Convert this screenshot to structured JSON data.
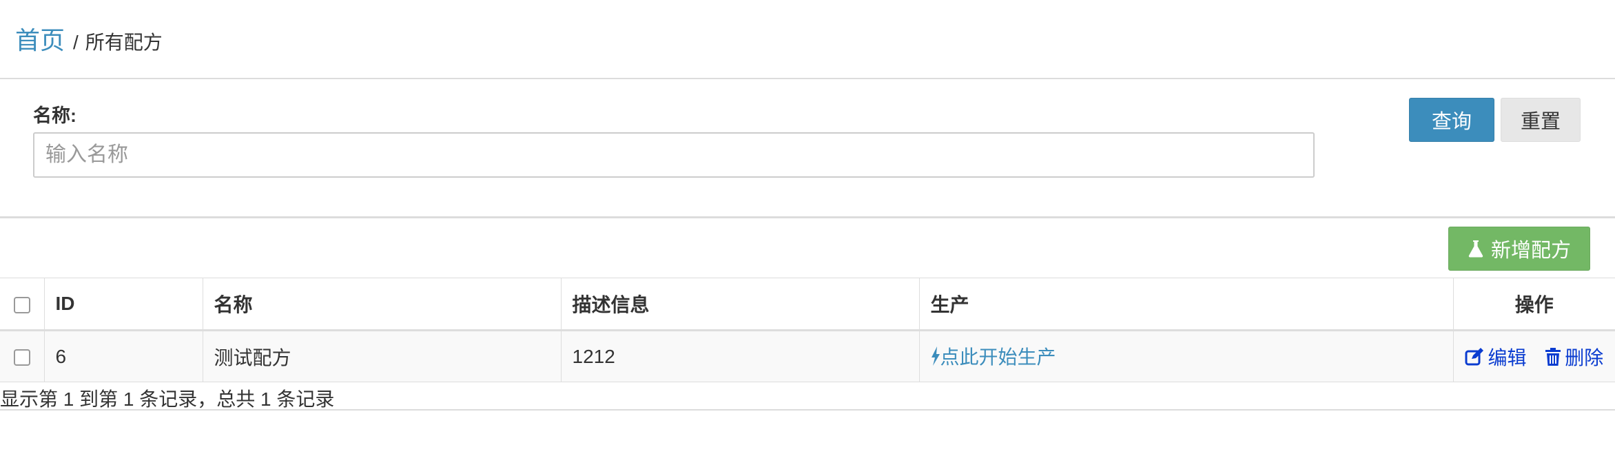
{
  "breadcrumb": {
    "home": "首页",
    "separator": "/",
    "current": "所有配方"
  },
  "filter": {
    "name_label": "名称:",
    "name_placeholder": "输入名称",
    "name_value": ""
  },
  "buttons": {
    "query": "查询",
    "reset": "重置",
    "add": "新增配方"
  },
  "table": {
    "headers": {
      "id": "ID",
      "name": "名称",
      "description": "描述信息",
      "production": "生产",
      "actions": "操作"
    },
    "rows": [
      {
        "id": "6",
        "name": "测试配方",
        "description": "1212",
        "production_link": "点此开始生产",
        "edit": "编辑",
        "delete": "删除"
      }
    ]
  },
  "pagination_info": "显示第 1 到第 1 条记录，总共 1 条记录",
  "icons": {
    "add": "flask-icon",
    "production": "bolt-icon",
    "edit": "edit-icon",
    "delete": "trash-icon"
  },
  "colors": {
    "primary": "#3c8dbc",
    "success": "#73b865",
    "action_link": "#0a3cd0"
  }
}
